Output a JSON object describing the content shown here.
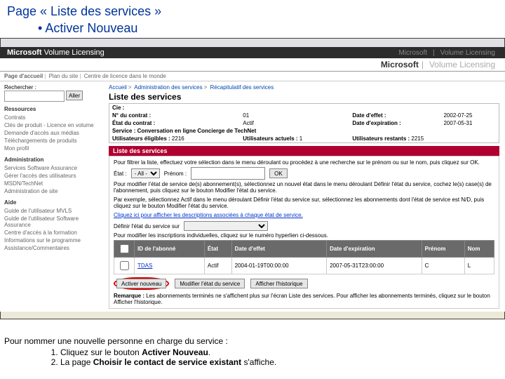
{
  "slide": {
    "title_line1": "Page « Liste des services »",
    "title_line2": "Activer Nouveau",
    "footer_intro": "Pour nommer une nouvelle personne en charge du service :",
    "footer_step1a": "Cliquez sur le bouton ",
    "footer_step1b": "Activer Nouveau",
    "footer_step1c": ".",
    "footer_step2a": "La page ",
    "footer_step2b": "Choisir le contact de service existant",
    "footer_step2c": " s'affiche."
  },
  "brand": {
    "ms": "Microsoft",
    "vl": "Volume Licensing"
  },
  "topbar": {
    "home": "Page d'accueil",
    "sitemap": "Plan du site",
    "centers": "Centre de licence dans le monde"
  },
  "left": {
    "search_label": "Rechercher :",
    "go": "Aller",
    "h_res": "Ressources",
    "res": [
      "Contrats",
      "Clés de produit - Licence en volume",
      "Demande d'accès aux médias",
      "Téléchargements de produits",
      "Mon profil"
    ],
    "h_admin": "Administration",
    "admin": [
      "Services Software Assurance",
      "Gérer l'accès des utilisateurs",
      "MSDN/TechNet",
      "Administration de site"
    ],
    "h_help": "Aide",
    "help": [
      "Guide de l'utilisateur MVLS",
      "Guide de l'utilisateur Software Assurance",
      "Centre d'accès à la formation",
      "Informations sur le programme",
      "Assistance/Commentaires"
    ]
  },
  "bc": {
    "home": "Accueil",
    "a": "Administration des services",
    "b": "Récapitulatif des services"
  },
  "page_title": "Liste des services",
  "info": {
    "cie_l": "Cie :",
    "num_l": "N° du contrat :",
    "num_v": "01",
    "eff_l": "Date d'effet :",
    "eff_v": "2002-07-25",
    "etat_l": "État du contrat :",
    "etat_v": "Actif",
    "exp_l": "Date d'expiration :",
    "exp_v": "2007-05-31",
    "svc_l": "Service : Conversation en ligne Concierge de TechNet",
    "elig_l": "Utilisateurs éligibles : ",
    "elig_v": "2216",
    "act_l": "Utilisateurs actuels : ",
    "act_v": "1",
    "rest_l": "Utilisateurs restants : ",
    "rest_v": "2215"
  },
  "sectionbar": "Liste des services",
  "filter": {
    "instr": "Pour filtrer la liste, effectuez votre sélection dans le menu déroulant ou procédez à une recherche sur le prénom ou sur le nom, puis cliquez sur OK.",
    "etat_l": "État :",
    "etat_opt": "- All -",
    "prenom_l": "Prénom :",
    "ok": "OK",
    "para1": "Pour modifier l'état de service de(s) abonnement(s), sélectionnez un nouvel état dans le menu déroulant Définir l'état du service, cochez le(s) case(s) de l'abonnement, puis cliquez sur le bouton Modifier l'état du service.",
    "para2": "Par exemple, sélectionnez Actif dans le menu déroulant Définir l'état du service sur, sélectionnez les abonnements dont l'état de service est N/D, puis cliquez sur le bouton Modifier l'état du service.",
    "linktext": "Cliquez ici pour afficher les descriptions associées à chaque état de service.",
    "define_l": "Définir l'état du service sur",
    "inscr": "Pour modifier les inscriptions individuelles, cliquez sur le numéro hyperlien ci-dessous."
  },
  "table": {
    "h1": "ID de l'abonné",
    "h2": "État",
    "h3": "Date d'effet",
    "h4": "Date d'expiration",
    "h5": "Prénom",
    "h6": "Nom",
    "r1": {
      "id": "TDAS",
      "etat": "Actif",
      "eff": "2004-01-19T00:00:00",
      "exp": "2007-05-31T23:00:00",
      "pre": "C",
      "nom": "L"
    }
  },
  "actions": {
    "activer": "Activer nouveau",
    "modifier": "Modifier l'état du service",
    "afficher": "Afficher l'historique"
  },
  "remark": {
    "label": "Remarque : ",
    "text": "Les abonnements terminés ne s'affichent plus sur l'écran Liste des services. Pour afficher les abonnements terminés, cliquez sur le bouton Afficher l'historique."
  }
}
